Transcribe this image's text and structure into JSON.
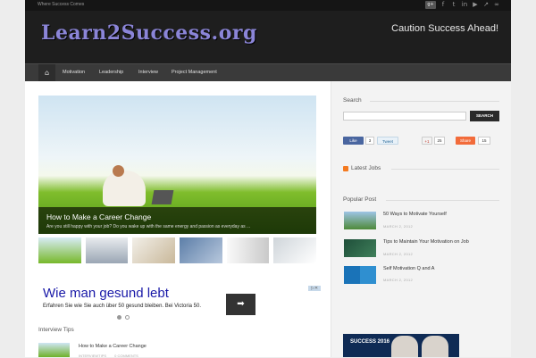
{
  "topbar": {
    "tagline": "Where Success Comes"
  },
  "social_icons": [
    "google-plus-icon",
    "facebook-icon",
    "twitter-icon",
    "linkedin-icon",
    "youtube-icon",
    "external-link-icon",
    "stumbleupon-icon"
  ],
  "header": {
    "logo_text": "Learn2Success.org",
    "caution": "Caution Success Ahead!"
  },
  "nav": {
    "items": [
      "Motivation",
      "Leadership",
      "Interview",
      "Project Management"
    ]
  },
  "slider": {
    "title": "How to Make a Career Change",
    "excerpt": "Are you still happy with your job? Do you wake up with the same energy and passion as everyday as ...",
    "thumb_count": 6
  },
  "ad": {
    "title": "Wie man gesund lebt",
    "text": "Erfahren Sie wie Sie auch über 50 gesund bleiben. Bei Victoria 50.",
    "close_label": "▷✕",
    "arrow": "➡"
  },
  "interview": {
    "section_title": "Interview Tips",
    "link": "How to Make a Career Change",
    "meta_author": "INTERVIEWTIPS",
    "meta_comments": "0 COMMENTS"
  },
  "sidebar": {
    "search_title": "Search",
    "search_button": "SEARCH",
    "share": {
      "like_label": "Like",
      "like_count": "3",
      "tweet_label": "Tweet",
      "gplus_label": "+1",
      "gplus_count": "25",
      "share_label": "Share",
      "share_count": "15"
    },
    "latest_jobs": "Latest Jobs",
    "popular_title": "Popular Post",
    "popular_posts": [
      {
        "title": "50 Ways to Motivate Yourself",
        "date": "MARCH 2, 2012"
      },
      {
        "title": "Tips to Maintain Your Motivation on Job",
        "date": "MARCH 2, 2012"
      },
      {
        "title": "Self Motivation Q and A",
        "date": "MARCH 2, 2012"
      }
    ],
    "bottom_ad": "SUCCESS 2016"
  },
  "colors": {
    "logo": "#8b85d8",
    "header_bg": "#1e1e1e",
    "nav_bg": "#3a3a3a",
    "ad_title": "#1a1aa8"
  }
}
